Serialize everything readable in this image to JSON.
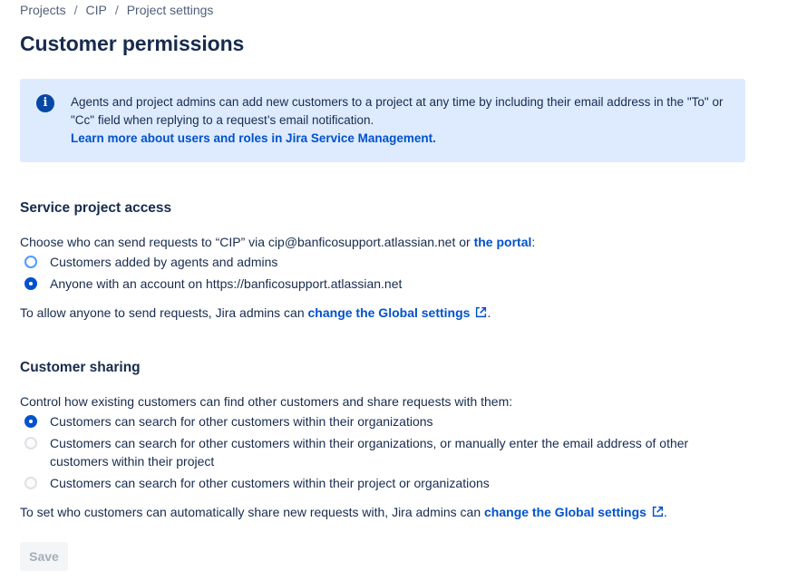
{
  "breadcrumb": [
    "Projects",
    "CIP",
    "Project settings"
  ],
  "page_title": "Customer permissions",
  "info": {
    "text": "Agents and project admins can add new customers to a project at any time by including their email address in the \"To\" or \"Cc\" field when replying to a request’s email notification.",
    "link": "Learn more about users and roles in Jira Service Management."
  },
  "access": {
    "heading": "Service project access",
    "intro_prefix": "Choose who can send requests to “CIP” via cip@banficosupport.atlassian.net or ",
    "intro_link": "the portal",
    "intro_suffix": ":",
    "options": [
      {
        "label": "Customers added by agents and admins",
        "checked": false
      },
      {
        "label": "Anyone with an account on https://banficosupport.atlassian.net",
        "checked": true
      }
    ],
    "footer_prefix": "To allow anyone to send requests, Jira admins can ",
    "footer_link": "change the Global settings",
    "footer_suffix": "."
  },
  "sharing": {
    "heading": "Customer sharing",
    "intro": "Control how existing customers can find other customers and share requests with them:",
    "options": [
      {
        "label": "Customers can search for other customers within their organizations",
        "checked": true
      },
      {
        "label_line1": "Customers can search for other customers within their organizations, or manually enter the email address of other",
        "label_line2": "customers within their project",
        "checked": false
      },
      {
        "label": "Customers can search for other customers within their project or organizations",
        "checked": false
      }
    ],
    "footer_prefix": "To set who customers can automatically share new requests with, Jira admins can ",
    "footer_link": "change the Global settings",
    "footer_suffix": "."
  },
  "save_label": "Save",
  "colors": {
    "primary": "#0052cc",
    "info_bg": "#deebff",
    "text": "#172b4d"
  }
}
